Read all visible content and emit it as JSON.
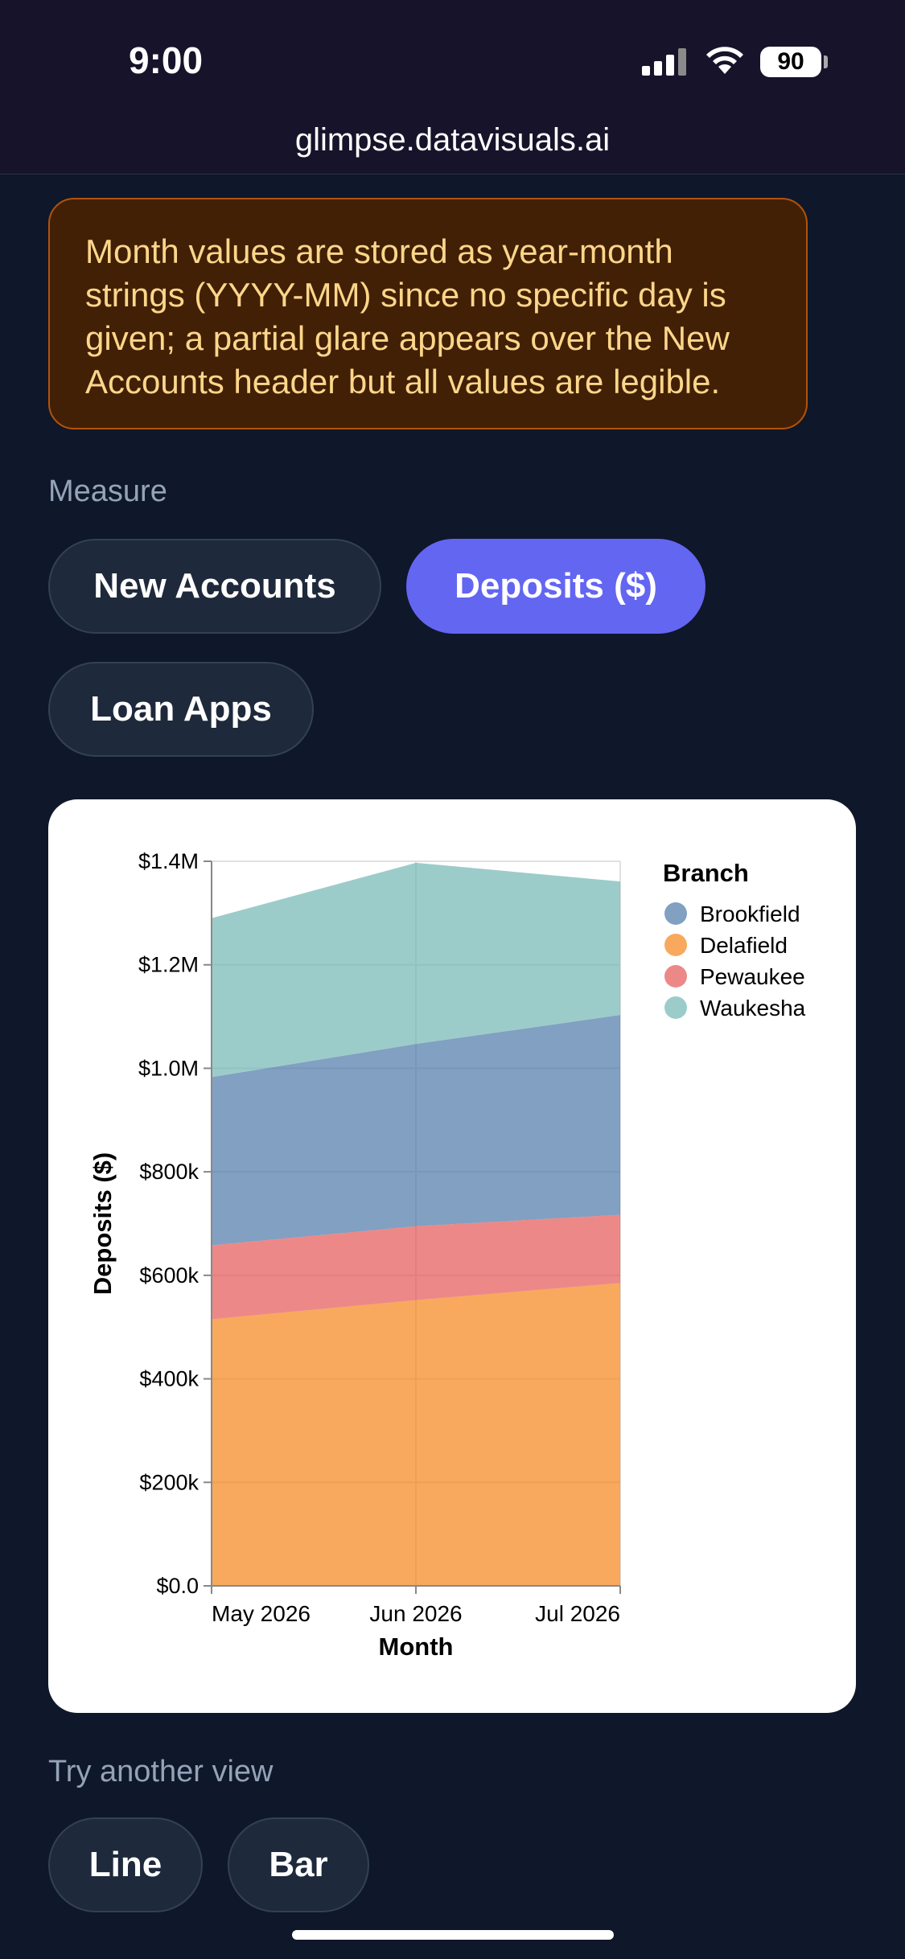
{
  "status_bar": {
    "time": "9:00",
    "battery": "90",
    "url": "glimpse.datavisuals.ai"
  },
  "notice": {
    "text": "Month values are stored as year-month strings (YYYY-MM) since no specific day is given; a partial glare appears over the New Accounts header but all values are legible."
  },
  "measure": {
    "label": "Measure",
    "options": [
      "New Accounts",
      "Deposits ($)",
      "Loan Apps"
    ],
    "selected": "Deposits ($)"
  },
  "other_views": {
    "label": "Try another view",
    "options": [
      "Line",
      "Bar"
    ]
  },
  "colors": {
    "accent": "#6366f1",
    "Brookfield": "#4c78a8",
    "Delafield": "#f58518",
    "Pewaukee": "#e45756",
    "Waukesha": "#72b7b2"
  },
  "chart_data": {
    "type": "area",
    "stacked": true,
    "categories": [
      "May 2026",
      "Jun 2026",
      "Jul 2026"
    ],
    "xlabel": "Month",
    "ylabel": "Deposits ($)",
    "ylim": [
      0,
      1400000
    ],
    "yticks": [
      0,
      200000,
      400000,
      600000,
      800000,
      1000000,
      1200000,
      1400000
    ],
    "ytick_labels": [
      "$0.0",
      "$200k",
      "$400k",
      "$600k",
      "$800k",
      "$1.0M",
      "$1.2M",
      "$1.4M"
    ],
    "legend_title": "Branch",
    "legend_position": "right",
    "legend_entries": [
      "Brookfield",
      "Delafield",
      "Pewaukee",
      "Waukesha"
    ],
    "grid": true,
    "stack_order": [
      "Delafield",
      "Pewaukee",
      "Brookfield",
      "Waukesha"
    ],
    "series": [
      {
        "name": "Delafield",
        "values": [
          515000,
          552000,
          585000
        ]
      },
      {
        "name": "Pewaukee",
        "values": [
          143000,
          143000,
          132000
        ]
      },
      {
        "name": "Brookfield",
        "values": [
          325000,
          352000,
          386000
        ]
      },
      {
        "name": "Waukesha",
        "values": [
          307000,
          350000,
          258000
        ]
      }
    ]
  }
}
